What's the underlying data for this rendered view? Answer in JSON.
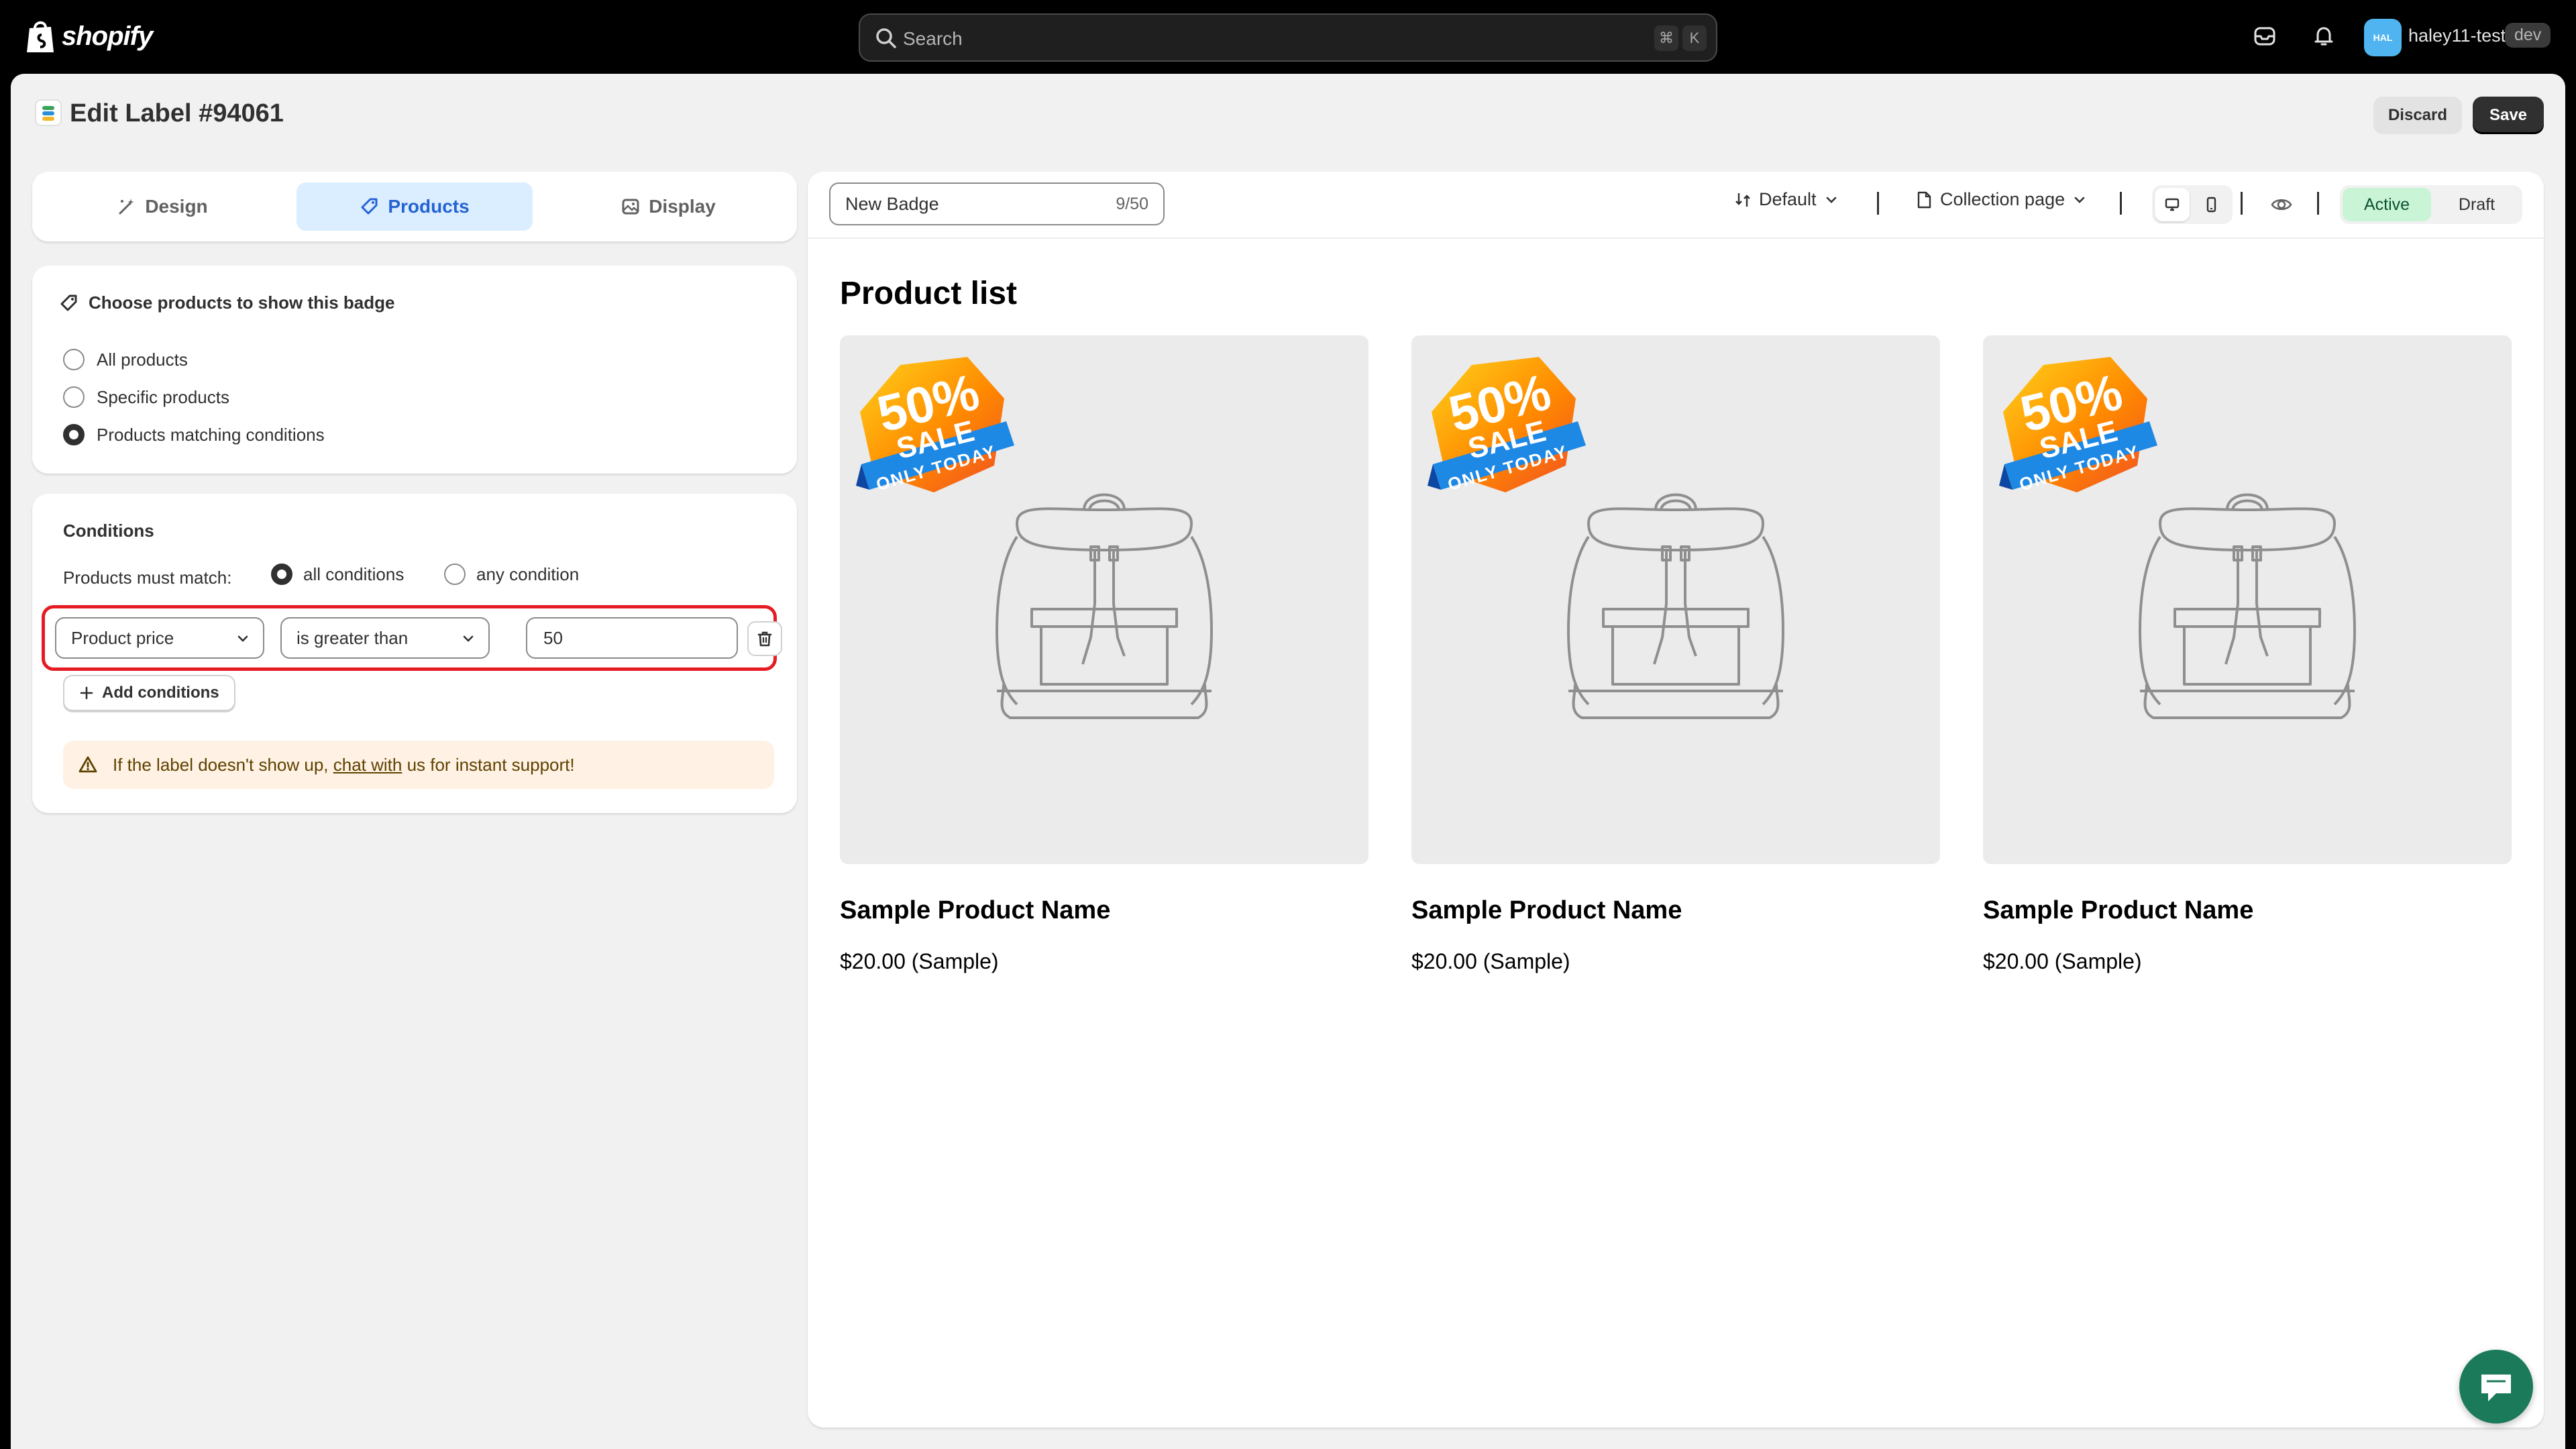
{
  "topbar": {
    "brand": "shopify",
    "search_placeholder": "Search",
    "shortcut_key1": "⌘",
    "shortcut_key2": "K",
    "avatar_initials": "HAL",
    "store_name": "haley11-test",
    "env_badge": "dev"
  },
  "page": {
    "title": "Edit Label #94061",
    "discard_label": "Discard",
    "save_label": "Save"
  },
  "tabs": [
    {
      "label": "Design",
      "icon": "magic-wand-icon",
      "active": false
    },
    {
      "label": "Products",
      "icon": "tag-icon",
      "active": true
    },
    {
      "label": "Display",
      "icon": "image-icon",
      "active": false
    }
  ],
  "choose": {
    "heading": "Choose products to show this badge",
    "options": [
      {
        "label": "All products",
        "selected": false
      },
      {
        "label": "Specific products",
        "selected": false
      },
      {
        "label": "Products matching conditions",
        "selected": true
      }
    ]
  },
  "conditions": {
    "title": "Conditions",
    "match_label": "Products must match:",
    "match_all": "all conditions",
    "match_any": "any condition",
    "match_selected": "all",
    "rule": {
      "field": "Product price",
      "operator": "is greater than",
      "value": "50"
    },
    "add_label": "Add conditions",
    "warning_before": "If the label doesn't show up, ",
    "warning_link": "chat with",
    "warning_after": " us for instant support!"
  },
  "preview": {
    "badge_name": "New Badge",
    "badge_count": "9/50",
    "template": "Default",
    "page_type": "Collection page",
    "device_selected": "desktop",
    "status_active": "Active",
    "status_draft": "Draft",
    "status_selected": "Active",
    "list_title": "Product list",
    "products": [
      {
        "name": "Sample Product Name",
        "price": "$20.00 (Sample)"
      },
      {
        "name": "Sample Product Name",
        "price": "$20.00 (Sample)"
      },
      {
        "name": "Sample Product Name",
        "price": "$20.00 (Sample)"
      }
    ],
    "sale_badge": {
      "big": "50%",
      "mid": "SALE",
      "ribbon": "ONLY TODAY"
    }
  },
  "colors": {
    "active_tab_bg": "#dbeeff",
    "active_tab_text": "#2463d3",
    "highlight_border": "#e51c23",
    "status_active_bg": "#c9f5d6",
    "chat_fab": "#1a7a5a"
  }
}
